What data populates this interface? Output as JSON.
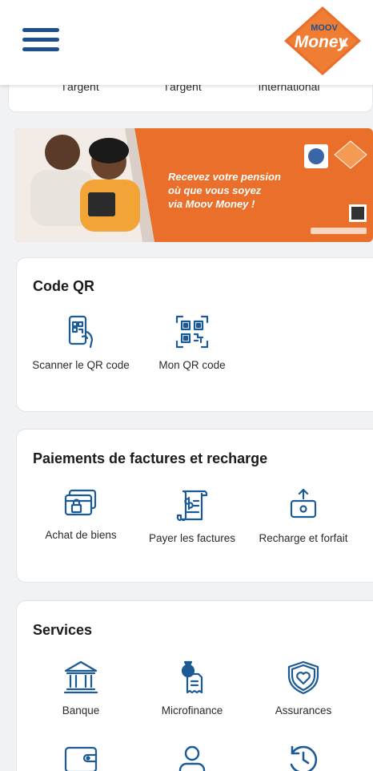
{
  "header": {
    "brand_top": "MOOV",
    "brand_main": "Money"
  },
  "top_card": {
    "items": [
      "l'argent",
      "l'argent",
      "International"
    ]
  },
  "banner": {
    "line1": "Recevez votre pension",
    "line2": "où que vous soyez",
    "line3": "via Moov Money !"
  },
  "qr_section": {
    "title": "Code QR",
    "items": [
      {
        "label": "Scanner le QR code",
        "icon": "qr-scan-phone-icon"
      },
      {
        "label": "Mon QR code",
        "icon": "qr-code-icon"
      }
    ]
  },
  "payments_section": {
    "title": "Paiements de factures et recharge",
    "items": [
      {
        "label": "Achat de biens",
        "icon": "card-purchase-icon"
      },
      {
        "label": "Payer les factures",
        "icon": "bill-icon"
      },
      {
        "label": "Recharge et forfait",
        "icon": "topup-icon"
      }
    ]
  },
  "services_section": {
    "title": "Services",
    "items": [
      {
        "label": "Banque",
        "icon": "bank-icon"
      },
      {
        "label": "Microfinance",
        "icon": "microfinance-icon"
      },
      {
        "label": "Assurances",
        "icon": "insurance-icon"
      }
    ],
    "more_icons": [
      "wallet-icon",
      "user-icon",
      "history-icon"
    ]
  },
  "colors": {
    "brand_blue": "#1f4f8e",
    "brand_orange": "#e96f2a",
    "icon_blue": "#1c5a96"
  }
}
